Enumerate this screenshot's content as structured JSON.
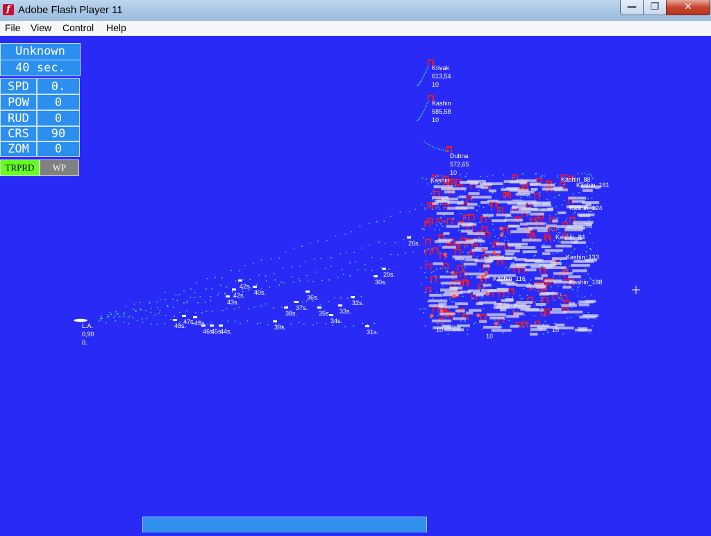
{
  "window": {
    "title": "Adobe Flash Player 11",
    "app_icon_glyph": "f"
  },
  "menu": [
    "File",
    "View",
    "Control",
    "Help"
  ],
  "hud": {
    "contact": "Unknown",
    "time": "40 sec.",
    "rows": [
      {
        "label": "SPD",
        "value": "0."
      },
      {
        "label": "POW",
        "value": "0"
      },
      {
        "label": "RUD",
        "value": "0"
      },
      {
        "label": "CRS",
        "value": "90"
      },
      {
        "label": "ZOM",
        "value": "0"
      }
    ],
    "buttons": [
      {
        "label": "TRPRD",
        "color": "#66ff22"
      },
      {
        "label": "WP",
        "color": "#808080"
      }
    ]
  },
  "player": {
    "name": "L.A.",
    "pos": "0,90",
    "speed": "0."
  },
  "ships": [
    {
      "name": "Krivak",
      "pos": "613,54",
      "speed": "10"
    },
    {
      "name": "Kashin",
      "pos": "585,58",
      "speed": "10"
    },
    {
      "name": "Dubna",
      "pos": "572,65",
      "speed": "10"
    }
  ],
  "cluster_labels": [
    "Kashin",
    "Kashin_88",
    "Kashin_161",
    "Kashin_124",
    "Kashin_133",
    "Kashin_188",
    "Kashin_84",
    "Kashin_116",
    "10",
    "_18",
    "10",
    "10"
  ],
  "time_markers": [
    "26s.",
    "29s.",
    "30s.",
    "31s.",
    "32s.",
    "33s.",
    "34s.",
    "35s.",
    "36s.",
    "37s.",
    "38s.",
    "39s.",
    "40s.",
    "42s.",
    "42s.",
    "43s.",
    "44s.",
    "45s.",
    "46s.",
    "46s.",
    "47s.",
    "48s."
  ],
  "colors": {
    "water": "#2a2af7",
    "ship": "#ff1a1a",
    "trail": "#33ddee",
    "marker": "#ffffff"
  }
}
